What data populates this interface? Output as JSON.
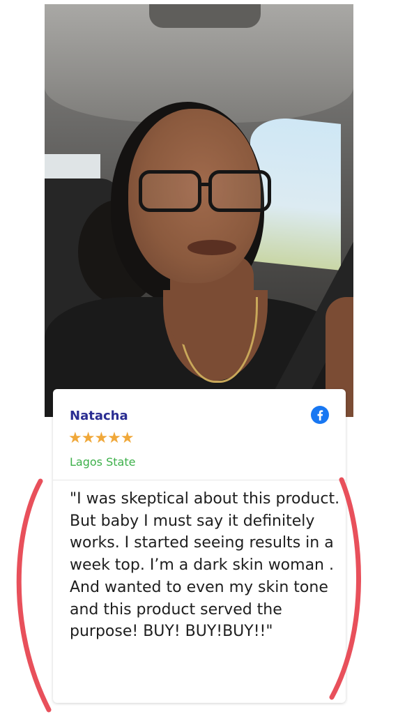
{
  "photo": {
    "alt": "Reviewer selfie in car"
  },
  "review": {
    "name": "Natacha",
    "stars": "★★★★★",
    "rating": 5,
    "location": "Lagos State",
    "platform_icon": "facebook-icon",
    "text": "\"I was skeptical about this product. But baby I must say it definitely works. I started seeing results in a week top. I’m a dark skin woman . And wanted to even my skin tone and this product served the purpose! BUY! BUY!BUY!!\""
  },
  "colors": {
    "name": "#2a2d92",
    "stars": "#f0a83a",
    "location": "#3db04a",
    "facebook": "#1877f2",
    "annotation": "#e8505b"
  }
}
